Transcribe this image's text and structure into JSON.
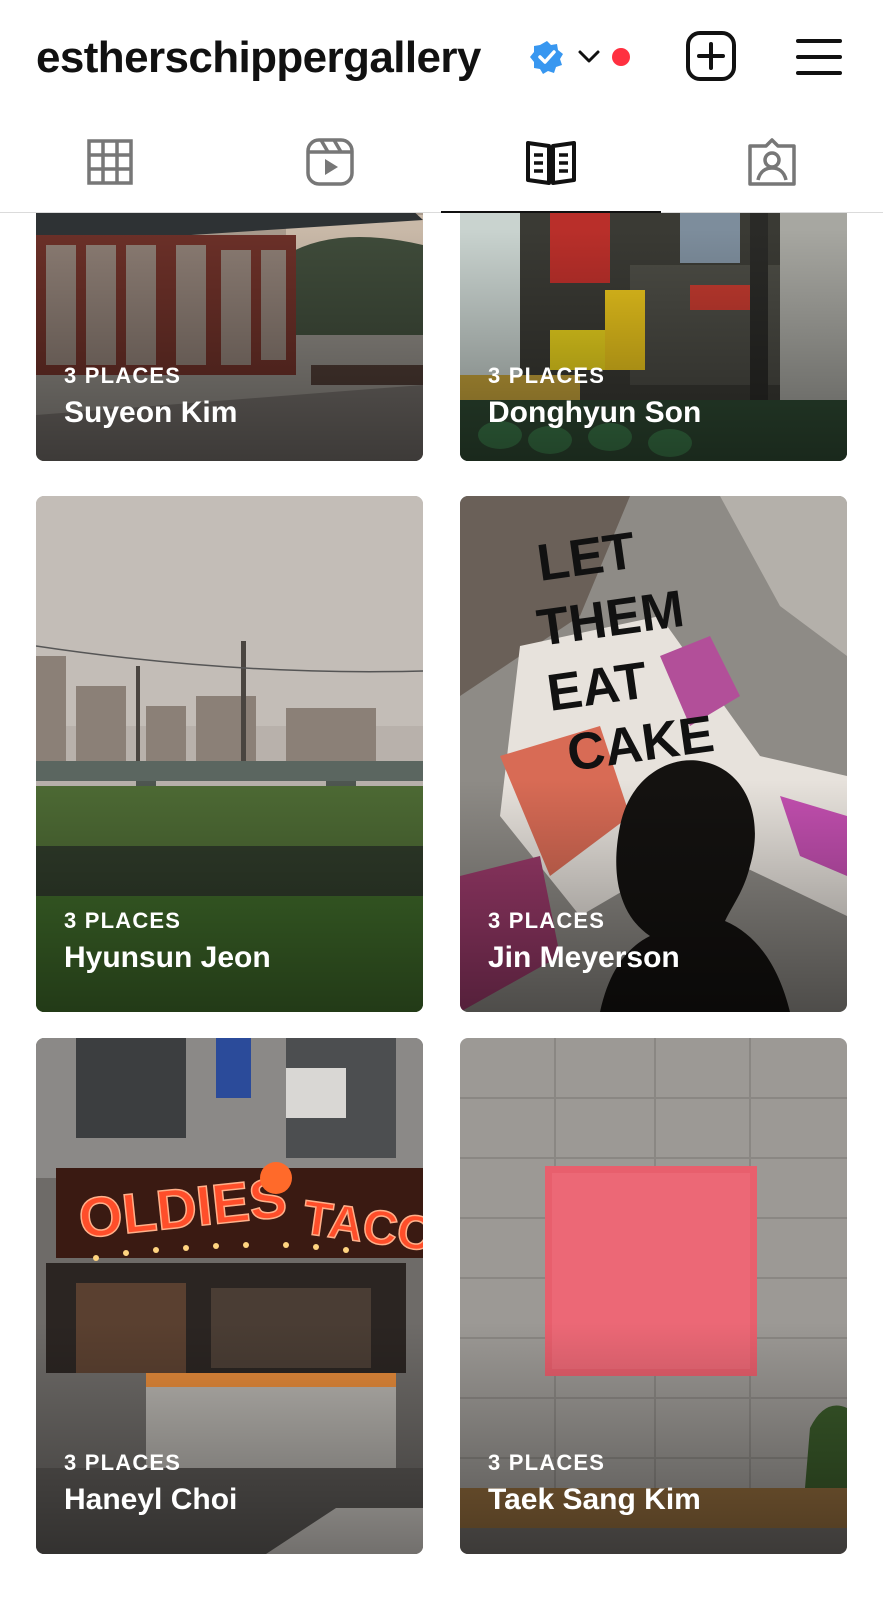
{
  "header": {
    "username": "estherschippergallery",
    "verified_icon": "verified-badge-icon",
    "dropdown_icon": "chevron-down-icon",
    "notification_dot_color": "#ff3040",
    "add_icon": "plus-square-icon",
    "menu_icon": "hamburger-menu-icon"
  },
  "tabs": [
    {
      "name": "posts",
      "icon": "grid-icon",
      "active": false
    },
    {
      "name": "reels",
      "icon": "reels-icon",
      "active": false
    },
    {
      "name": "guides",
      "icon": "guides-book-icon",
      "active": true
    },
    {
      "name": "tagged",
      "icon": "tagged-user-icon",
      "active": false
    }
  ],
  "guides": [
    {
      "places": "3 PLACES",
      "name": "Suyeon Kim"
    },
    {
      "places": "3 PLACES",
      "name": "Donghyun Son"
    },
    {
      "places": "3 PLACES",
      "name": "Hyunsun Jeon"
    },
    {
      "places": "3 PLACES",
      "name": "Jin Meyerson"
    },
    {
      "places": "3 PLACES",
      "name": "Haneyl Choi"
    },
    {
      "places": "3 PLACES",
      "name": "Taek Sang Kim"
    }
  ],
  "artwork_text": {
    "poster": "LET THEM EAT CAKE",
    "sign_left": "OLDIES",
    "sign_right": "TACO"
  }
}
